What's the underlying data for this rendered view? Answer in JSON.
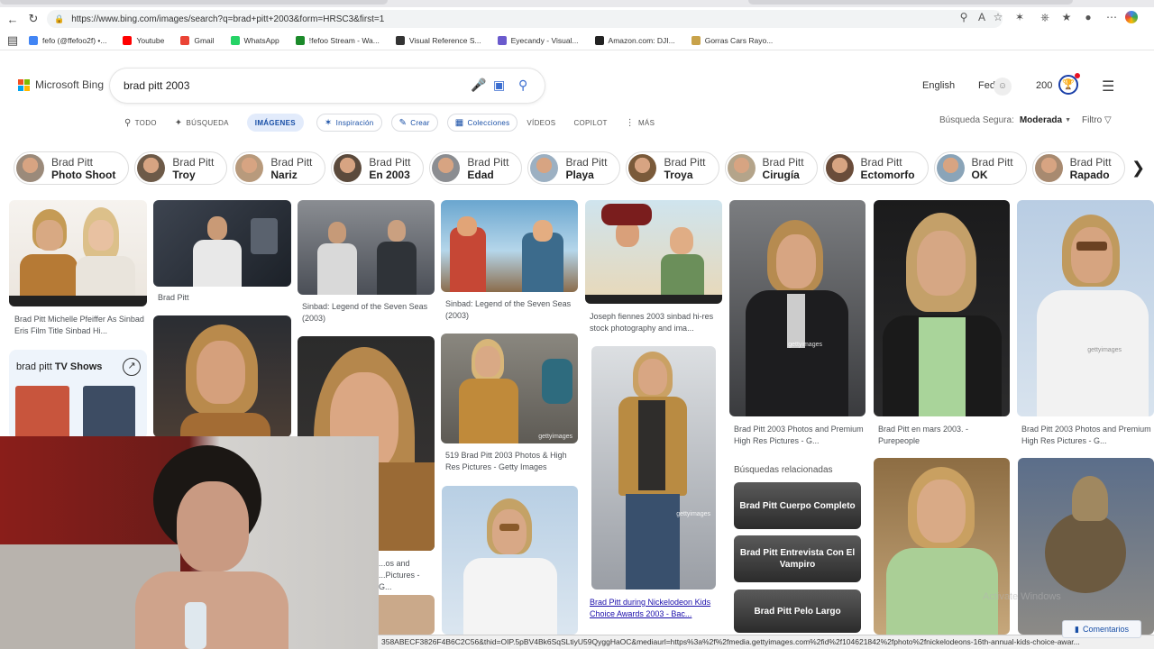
{
  "browser": {
    "url": "https://www.bing.com/images/search?q=brad+pitt+2003&form=HRSC3&first=1",
    "bookmarks": [
      {
        "label": "fefo (@ffefoo2f) •...",
        "icon": "globe-icon",
        "color": "#4285f4"
      },
      {
        "label": "Youtube",
        "icon": "youtube-icon",
        "color": "#ff0000"
      },
      {
        "label": "Gmail",
        "icon": "gmail-icon",
        "color": "#ea4335"
      },
      {
        "label": "WhatsApp",
        "icon": "whatsapp-icon",
        "color": "#25d366"
      },
      {
        "label": "!fefoo Stream - Wa...",
        "icon": "stream-icon",
        "color": "#1b8a2a"
      },
      {
        "label": "Visual Reference S...",
        "icon": "reference-icon",
        "color": "#333333"
      },
      {
        "label": "Eyecandy - Visual...",
        "icon": "eye-icon",
        "color": "#6a5acd"
      },
      {
        "label": "Amazon.com: DJI...",
        "icon": "amazon-icon",
        "color": "#222222"
      },
      {
        "label": "Gorras Cars Rayo...",
        "icon": "cap-icon",
        "color": "#c8a24a"
      }
    ],
    "status_url": "358ABECF3826F4B6C2C56&thid=OIP.5pBV4Bk6SqSLtiyU59QyggHaOC&mediaurl=https%3a%2f%2fmedia.gettyimages.com%2fid%2f104621842%2fphoto%2fnickelodeons-16th-annual-kids-choice-awar..."
  },
  "header": {
    "logo_text": "Microsoft Bing",
    "query": "brad pitt 2003",
    "language": "English",
    "user": "Fede",
    "points": "200"
  },
  "tabs": [
    {
      "label": "TODO",
      "icon": "search-icon"
    },
    {
      "label": "BÚSQUEDA",
      "icon": "copilot-icon"
    },
    {
      "label": "IMÁGENES",
      "icon": "",
      "active": true
    },
    {
      "label": "Inspiración",
      "icon": "sparkle-icon",
      "pill": true
    },
    {
      "label": "Crear",
      "icon": "create-icon",
      "pill": true
    },
    {
      "label": "Colecciones",
      "icon": "collections-icon",
      "pill": true
    },
    {
      "label": "VÍDEOS",
      "icon": ""
    },
    {
      "label": "COPILOT",
      "icon": ""
    },
    {
      "label": "MÁS",
      "icon": "more-icon"
    }
  ],
  "safe_search": {
    "label": "Búsqueda Segura:",
    "value": "Moderada"
  },
  "filter_label": "Filtro",
  "chips": [
    {
      "line1": "Brad Pitt",
      "line2": "Photo Shoot"
    },
    {
      "line1": "Brad Pitt",
      "line2": "Troy"
    },
    {
      "line1": "Brad Pitt",
      "line2": "Nariz"
    },
    {
      "line1": "Brad Pitt",
      "line2": "En 2003"
    },
    {
      "line1": "Brad Pitt",
      "line2": "Edad"
    },
    {
      "line1": "Brad Pitt",
      "line2": "Playa"
    },
    {
      "line1": "Brad Pitt",
      "line2": "Troya"
    },
    {
      "line1": "Brad Pitt",
      "line2": "Cirugía"
    },
    {
      "line1": "Brad Pitt",
      "line2": "Ectomorfo"
    },
    {
      "line1": "Brad Pitt",
      "line2": "OK"
    },
    {
      "line1": "Brad Pitt",
      "line2": "Rapado"
    }
  ],
  "captions": {
    "c1": "Brad Pitt Michelle Pfeiffer As Sinbad Eris Film Title Sinbad Hi...",
    "c2": "Brad Pitt",
    "c3": "Sinbad: Legend of the Seven Seas (2003)",
    "c4": "Sinbad: Legend of the Seven Seas (2003)",
    "c5": "Joseph fiennes 2003 sinbad hi-res stock photography and ima...",
    "c6": "Brad Pitt 2003 Photos and Premium High Res Pictures - G...",
    "c7": "Brad Pitt en mars 2003. - Purepeople",
    "c8": "Brad Pitt 2003 Photos and Premium High Res Pictures - G...",
    "c9": "519 Brad Pitt 2003 Photos & High Res Pictures - Getty Images",
    "c10": "Brad Pitt during Nickelodeon Kids Choice Awards 2003 - Bac...",
    "c11": "...os and\n...Pictures - G..."
  },
  "watermark": "gettyimages",
  "tv_shows": {
    "prefix": "brad pitt",
    "bold": "TV Shows"
  },
  "related": {
    "title": "Búsquedas relacionadas",
    "items": [
      "Brad Pitt Cuerpo Completo",
      "Brad Pitt Entrevista Con El Vampiro",
      "Brad Pitt Pelo Largo"
    ]
  },
  "feedback_label": "Comentarios",
  "activate_windows": "Activate Windows"
}
